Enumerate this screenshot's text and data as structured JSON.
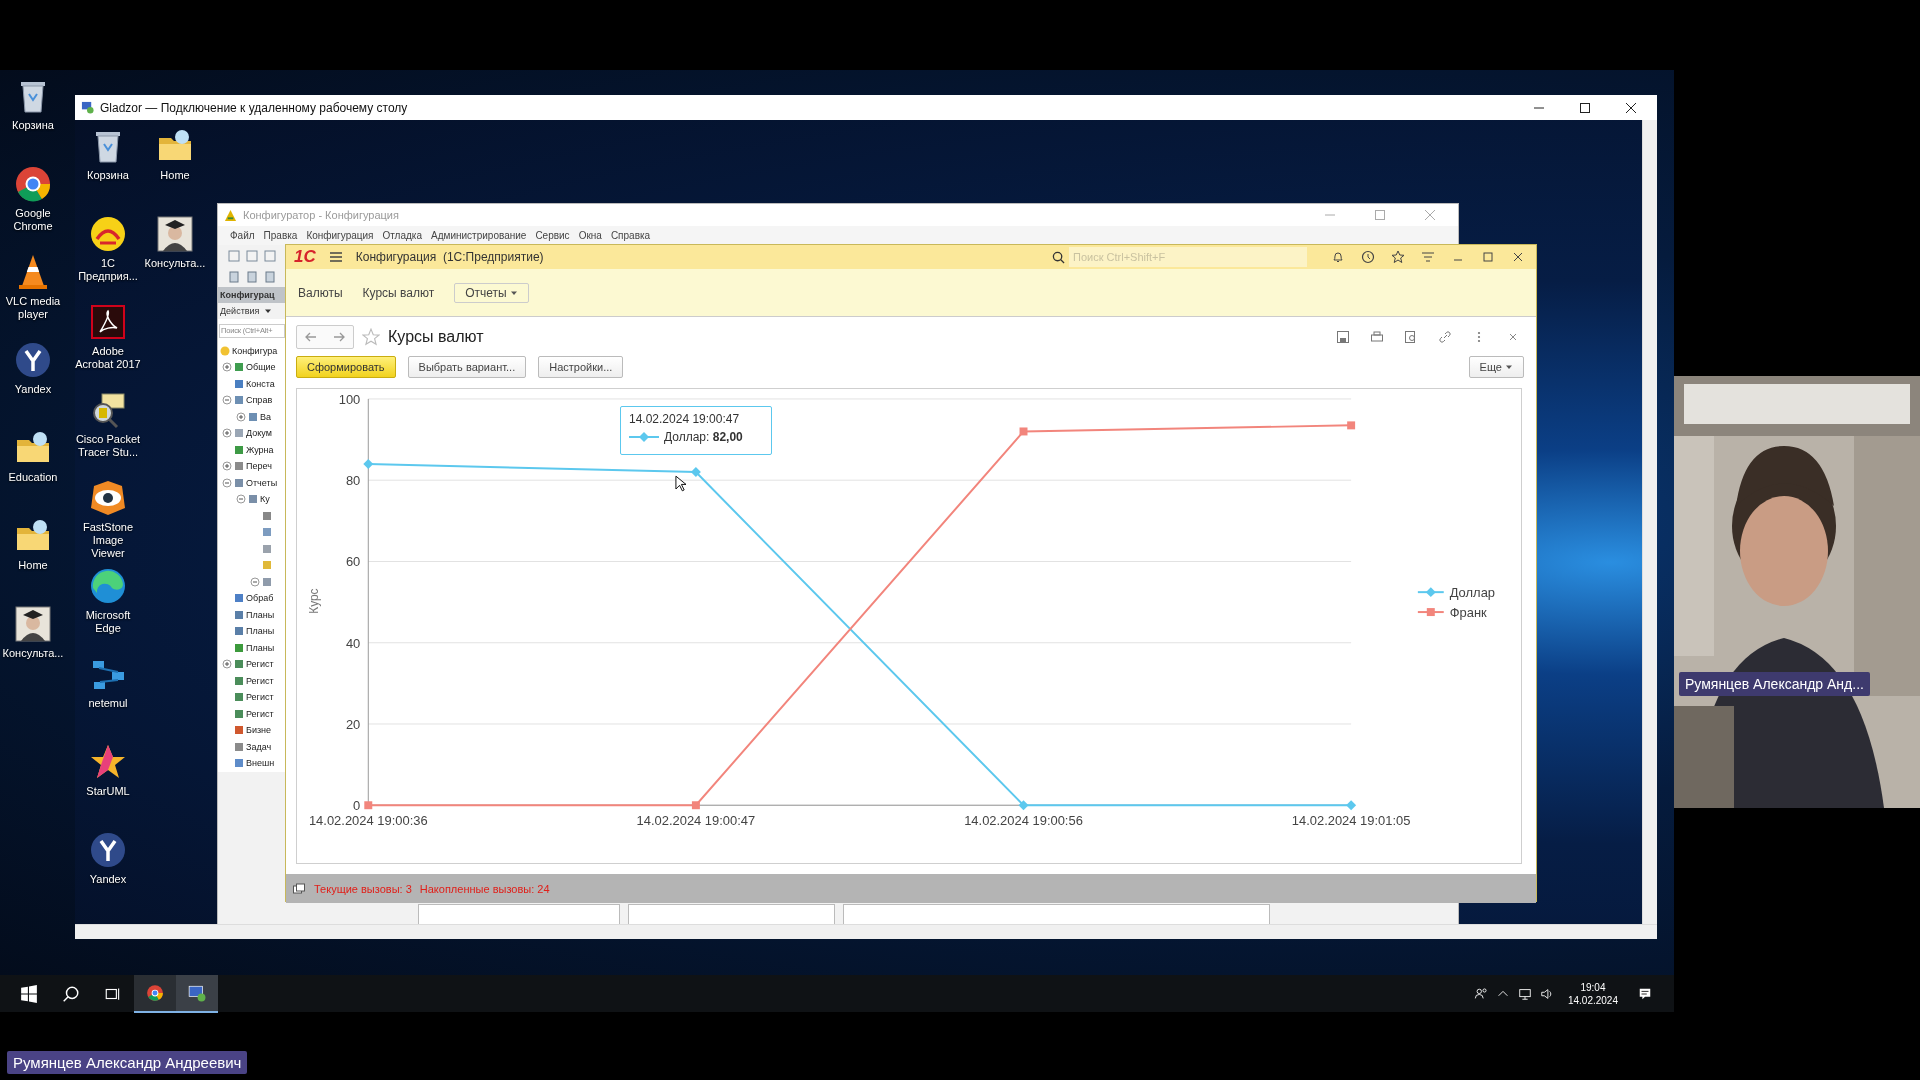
{
  "local_desktop": {
    "icons": [
      {
        "label": "Корзина",
        "kind": "bin"
      },
      {
        "label": "Google Chrome",
        "kind": "ring"
      },
      {
        "label": "VLC media player",
        "kind": "cone"
      },
      {
        "label": "Yandex",
        "kind": "fork"
      },
      {
        "label": "Education",
        "kind": "folder"
      },
      {
        "label": "Home",
        "kind": "folder"
      },
      {
        "label": "Консульта...",
        "kind": "scholar"
      }
    ]
  },
  "remote_window": {
    "title": "Gladzor — Подключение к удаленному рабочему столу"
  },
  "remote_desktop": {
    "icon_columns": [
      [
        {
          "label": "Корзина",
          "kind": "bin"
        },
        {
          "label": "1С Предприя...",
          "kind": "disc"
        },
        {
          "label": "Adobe Acrobat 2017",
          "kind": "acrobat"
        },
        {
          "label": "Cisco Packet Tracer Stu...",
          "kind": "cisco"
        },
        {
          "label": "FastStone Image Viewer",
          "kind": "eye"
        },
        {
          "label": "Microsoft Edge",
          "kind": "swirl"
        },
        {
          "label": "netemul",
          "kind": "network"
        },
        {
          "label": "StarUML",
          "kind": "star"
        },
        {
          "label": "Yandex",
          "kind": "fork"
        }
      ],
      [
        {
          "label": "Home",
          "kind": "folder"
        },
        {
          "label": "Консульта...",
          "kind": "scholar"
        }
      ]
    ]
  },
  "configurator": {
    "title": "Конфигуратор - Конфигурация",
    "menu": [
      "Файл",
      "Правка",
      "Конфигурация",
      "Отладка",
      "Администрирование",
      "Сервис",
      "Окна",
      "Справка"
    ],
    "panel_title": "Конфигурац",
    "actions": "Действия",
    "search": {
      "placeholder": "Поиск (Ctrl+Alt+"
    },
    "tree": [
      {
        "label": "Конфигура",
        "kind": "root",
        "children": [
          {
            "label": "Общие",
            "kind": "common",
            "expanded": false
          },
          {
            "label": "Конста",
            "kind": "constants"
          },
          {
            "label": "Справ",
            "kind": "catalogs",
            "expanded": true,
            "children": [
              {
                "label": "Ва",
                "kind": "catalogs",
                "expanded": false
              }
            ]
          },
          {
            "label": "Докум",
            "kind": "documents",
            "expanded": false
          },
          {
            "label": "Журна",
            "kind": "journals"
          },
          {
            "label": "Переч",
            "kind": "enums",
            "expanded": false
          },
          {
            "label": "Отчеты",
            "kind": "reports",
            "expanded": true,
            "children": [
              {
                "label": "Ку",
                "kind": "reports",
                "expanded": true,
                "children": [
                  {
                    "kind": "attribute"
                  },
                  {
                    "kind": "form"
                  },
                  {
                    "kind": "template"
                  },
                  {
                    "kind": "module"
                  },
                  {
                    "kind": "layout",
                    "expanded": true
                  }
                ]
              }
            ]
          },
          {
            "label": "Обраб",
            "kind": "processing"
          },
          {
            "label": "Планы",
            "kind": "plan"
          },
          {
            "label": "Планы",
            "kind": "plan"
          },
          {
            "label": "Планы",
            "kind": "accounts"
          },
          {
            "label": "Регист",
            "kind": "register",
            "expanded": false
          },
          {
            "label": "Регист",
            "kind": "register"
          },
          {
            "label": "Регист",
            "kind": "register"
          },
          {
            "label": "Регист",
            "kind": "register"
          },
          {
            "label": "Бизне",
            "kind": "business"
          },
          {
            "label": "Задач",
            "kind": "tasks"
          },
          {
            "label": "Внешн",
            "kind": "external"
          }
        ]
      }
    ]
  },
  "one_c": {
    "logo": "1С",
    "title": "Конфигурация  (1С:Предприятие)",
    "search": {
      "placeholder": "Поиск Ctrl+Shift+F"
    },
    "sections": [
      {
        "label": "Валюты",
        "kind": "link"
      },
      {
        "label": "Курсы валют",
        "kind": "link"
      },
      {
        "label": "Отчеты",
        "kind": "dropdown"
      }
    ],
    "page_title": "Курсы валют",
    "buttons": [
      {
        "label": "Сформировать",
        "kind": "primary"
      },
      {
        "label": "Выбрать вариант...",
        "kind": "normal"
      },
      {
        "label": "Настройки...",
        "kind": "normal"
      }
    ],
    "more_button": "Еще",
    "chart": {
      "chart_data": {
        "type": "line",
        "ylabel": "Курс",
        "categories": [
          "14.02.2024 19:00:36",
          "14.02.2024 19:00:47",
          "14.02.2024 19:00:56",
          "14.02.2024 19:01:05"
        ],
        "ylim": [
          0,
          100
        ],
        "yticks": [
          0,
          20,
          40,
          60,
          80,
          100
        ],
        "grid": true,
        "legend": "right",
        "series": [
          {
            "name": "Доллар",
            "color": "#5cc8ee",
            "marker": "diamond",
            "values": [
              84,
              82,
              0,
              0
            ]
          },
          {
            "name": "Франк",
            "color": "#f2857c",
            "marker": "square",
            "values": [
              0,
              0,
              92,
              93.5
            ]
          }
        ]
      },
      "tooltip": {
        "title": "14.02.2024 19:00:47",
        "text": "Доллар: **82,00**"
      }
    },
    "status": [
      "Текущие вызовы: 3",
      "Накопленные вызовы: 24"
    ]
  },
  "taskbar": {
    "time": "19:04",
    "date": "14.02.2024"
  },
  "meeting": {
    "camera_label": "Румянцев Александр Анд...",
    "presenter_name": "Румянцев Александр Андреевич"
  }
}
